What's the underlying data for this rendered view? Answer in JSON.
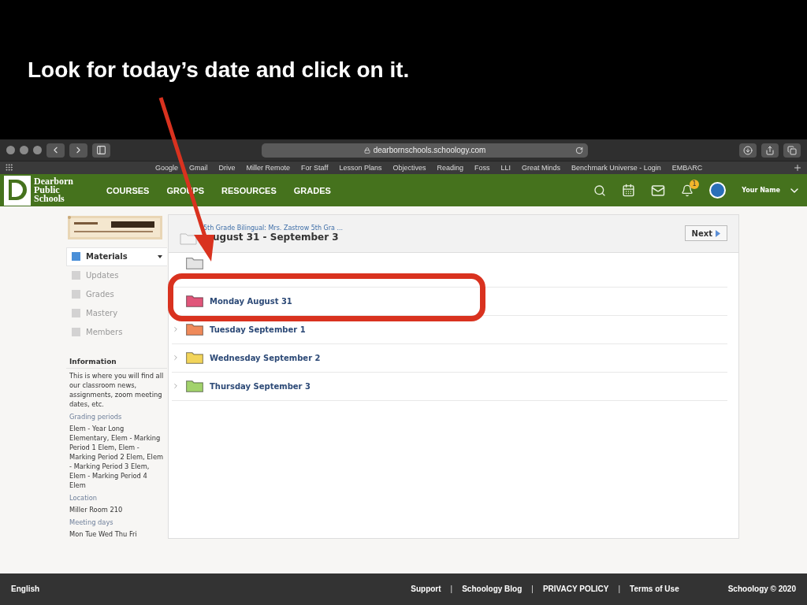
{
  "slide": {
    "caption": "Look for today’s date and click on it."
  },
  "browser": {
    "url": "dearbornschools.schoology.com",
    "bookmarks": [
      "Google",
      "Gmail",
      "Drive",
      "Miller Remote",
      "For Staff",
      "Lesson Plans",
      "Objectives",
      "Reading",
      "Foss",
      "LLI",
      "Great Minds",
      "Benchmark Universe - Login",
      "EMBARC"
    ]
  },
  "nav": {
    "brand": [
      "Dearborn",
      "Public",
      "Schools"
    ],
    "links": [
      "COURSES",
      "GROUPS",
      "RESOURCES",
      "GRADES"
    ],
    "notification_count": "1",
    "user": "Your Name"
  },
  "sidebar": {
    "items": [
      {
        "label": "Materials",
        "selected": true
      },
      {
        "label": "Updates",
        "selected": false
      },
      {
        "label": "Grades",
        "selected": false
      },
      {
        "label": "Mastery",
        "selected": false
      },
      {
        "label": "Members",
        "selected": false
      }
    ],
    "information": {
      "title": "Information",
      "description": "This is where you will find all our classroom news, assignments, zoom meeting dates, etc.",
      "fields": [
        {
          "label": "Grading periods",
          "value": "Elem - Year Long Elementary, Elem - Marking Period 1 Elem, Elem -Marking Period 2 Elem, Elem - Marking Period 3 Elem, Elem - Marking Period 4 Elem"
        },
        {
          "label": "Location",
          "value": "Miller Room 210"
        },
        {
          "label": "Meeting days",
          "value": "Mon Tue Wed Thu Fri"
        }
      ]
    }
  },
  "main": {
    "breadcrumb": "5th Grade Bilingual: Mrs. Zastrow 5th Gra ...",
    "title": "ugust 31 - September 3",
    "next_button": "Next",
    "rows": [
      {
        "color": "#e4e4e4",
        "chevron": false
      },
      {
        "label": "Monday August 31",
        "color": "#e0567a",
        "chevron": false,
        "highlighted": true
      },
      {
        "label": "Tuesday September 1",
        "color": "#ef8a5a",
        "chevron": true,
        "highlighted": false
      },
      {
        "label": "Wednesday September 2",
        "color": "#f2d45a",
        "chevron": true,
        "highlighted": false
      },
      {
        "label": "Thursday September 3",
        "color": "#a2d26c",
        "chevron": true,
        "highlighted": false
      }
    ]
  },
  "footer": {
    "language": "English",
    "links": [
      {
        "kind": "link",
        "text": "Support"
      },
      {
        "kind": "separator",
        "text": "|"
      },
      {
        "kind": "link",
        "text": "Schoology Blog"
      },
      {
        "kind": "separator",
        "text": "|"
      },
      {
        "kind": "link",
        "text": "PRIVACY POLICY"
      },
      {
        "kind": "separator",
        "text": "|"
      },
      {
        "kind": "link",
        "text": "Terms of Use"
      }
    ],
    "copyright": "Schoology © 2020"
  }
}
